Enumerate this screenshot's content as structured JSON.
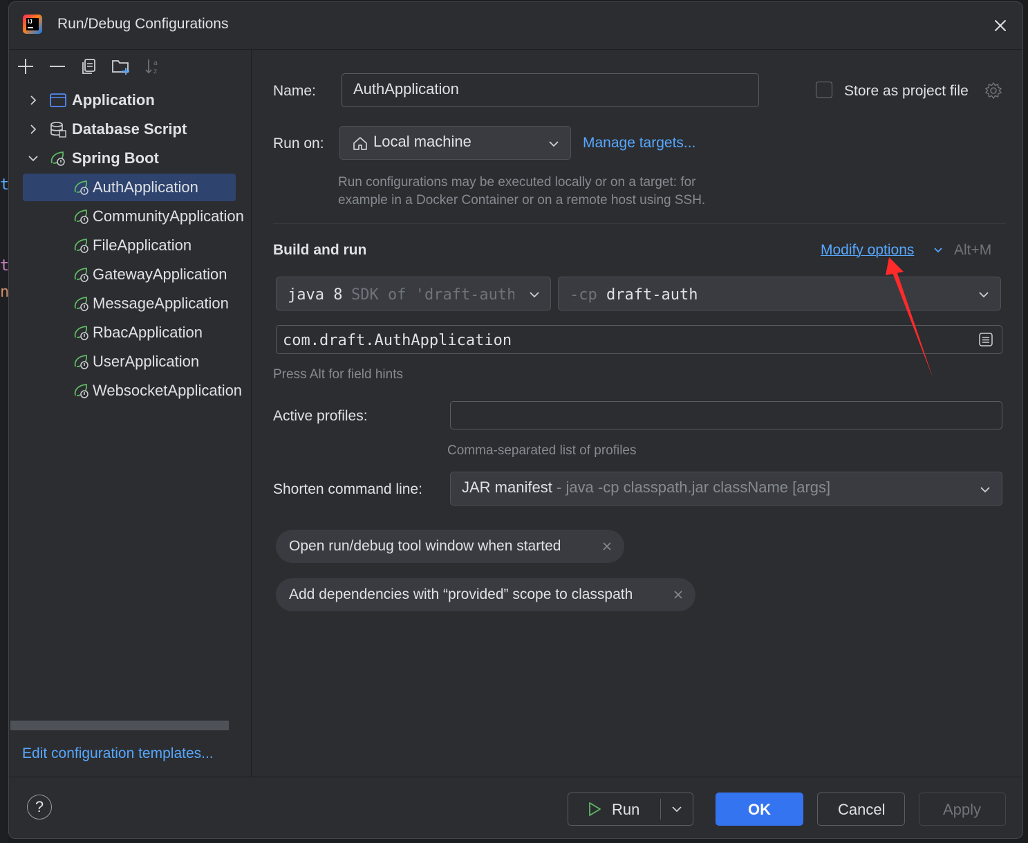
{
  "window": {
    "title": "Run/Debug Configurations"
  },
  "toolbar": {
    "add_icon": "plus-icon",
    "remove_icon": "minus-icon",
    "copy_icon": "copy-icon",
    "folder_icon": "new-folder-icon",
    "sort_icon": "sort-alpha-icon"
  },
  "tree": {
    "groups": [
      {
        "label": "Application",
        "icon": "application-icon",
        "expanded": false
      },
      {
        "label": "Database Script",
        "icon": "database-icon",
        "expanded": false
      },
      {
        "label": "Spring Boot",
        "icon": "spring-boot-icon",
        "expanded": true
      }
    ],
    "spring_items": [
      {
        "label": "AuthApplication",
        "selected": true
      },
      {
        "label": "CommunityApplication"
      },
      {
        "label": "FileApplication"
      },
      {
        "label": "GatewayApplication"
      },
      {
        "label": "MessageApplication"
      },
      {
        "label": "RbacApplication"
      },
      {
        "label": "UserApplication"
      },
      {
        "label": "WebsocketApplication"
      }
    ],
    "edit_templates": "Edit configuration templates..."
  },
  "form": {
    "name_label": "Name:",
    "name_value": "AuthApplication",
    "store_label": "Store as project file",
    "run_on_label": "Run on:",
    "run_on_value": "Local machine",
    "manage_targets": "Manage targets...",
    "run_on_hint_1": "Run configurations may be executed locally or on a target: for",
    "run_on_hint_2": "example in a Docker Container or on a remote host using SSH.",
    "section_title": "Build and run",
    "modify_options": "Modify options",
    "modify_shortcut": "Alt+M",
    "jdk_main": "java 8",
    "jdk_sub": "SDK of 'draft-auth'",
    "cp_prefix": "-cp",
    "cp_value": "draft-auth",
    "main_class": "com.draft.AuthApplication",
    "field_hint": "Press Alt for field hints",
    "active_profiles_label": "Active profiles:",
    "active_profiles_value": "",
    "profiles_hint": "Comma-separated list of profiles",
    "shorten_label": "Shorten command line:",
    "shorten_main": "JAR manifest",
    "shorten_sub": "- java -cp classpath.jar className [args]",
    "chips": [
      "Open run/debug tool window when started",
      "Add dependencies with “provided” scope to classpath"
    ]
  },
  "footer": {
    "help": "?",
    "run": "Run",
    "ok": "OK",
    "cancel": "Cancel",
    "apply": "Apply"
  },
  "colors": {
    "accent": "#3574f0",
    "link": "#57a7ff",
    "selection": "#2e436e",
    "annotation_arrow": "#ff3030"
  }
}
